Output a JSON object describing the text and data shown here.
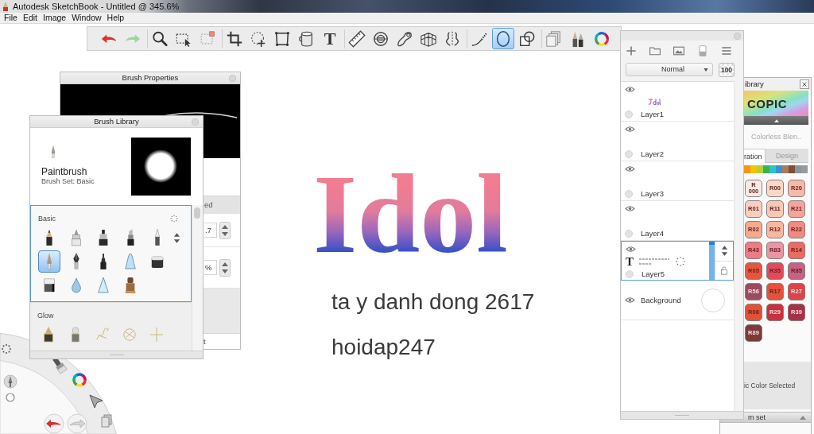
{
  "window": {
    "title": "Autodesk SketchBook - Untitled @ 345.6%"
  },
  "menu": [
    {
      "label": "File"
    },
    {
      "label": "Edit"
    },
    {
      "label": "Image"
    },
    {
      "label": "Window"
    },
    {
      "label": "Help"
    }
  ],
  "toolbar": {
    "groups": [
      {
        "tools": [
          {
            "kind": "undo",
            "selected": false
          },
          {
            "kind": "redo",
            "selected": false
          }
        ]
      },
      {
        "tools": [
          {
            "kind": "zoom",
            "selected": false
          },
          {
            "kind": "select",
            "selected": false
          },
          {
            "kind": "transform",
            "selected": false
          }
        ]
      },
      {
        "tools": [
          {
            "kind": "crop",
            "selected": false
          },
          {
            "kind": "move",
            "selected": false
          },
          {
            "kind": "distort",
            "selected": false
          },
          {
            "kind": "fill",
            "selected": false
          },
          {
            "kind": "text",
            "glyph": "T",
            "selected": false
          }
        ]
      },
      {
        "tools": [
          {
            "kind": "ruler",
            "selected": false
          },
          {
            "kind": "ellipse_guide",
            "selected": false
          },
          {
            "kind": "french_curve",
            "selected": false
          },
          {
            "kind": "perspective",
            "selected": false
          },
          {
            "kind": "symmetry",
            "selected": false
          }
        ]
      },
      {
        "tools": [
          {
            "kind": "stroke",
            "selected": false
          },
          {
            "kind": "ellipse",
            "selected": true
          },
          {
            "kind": "shapes",
            "selected": false
          }
        ]
      },
      {
        "tools": [
          {
            "kind": "copy",
            "selected": false
          },
          {
            "kind": "brushes",
            "selected": false
          },
          {
            "kind": "color",
            "selected": false
          }
        ]
      }
    ]
  },
  "canvas": {
    "lettering": "Idol",
    "lines": [
      "ta y danh dong 2617",
      "hoidap247"
    ]
  },
  "brush_properties": {
    "title": "Brush Properties",
    "tab": "ed",
    "fields": [
      {
        "value": ".7"
      },
      {
        "value": "%"
      }
    ],
    "footer": "t"
  },
  "brush_library": {
    "title": "Brush Library",
    "current": {
      "name": "Paintbrush",
      "set": "Brush Set: Basic"
    },
    "sets": [
      {
        "name": "Basic",
        "brushes": [
          {
            "kind": "pencil",
            "selected": false
          },
          {
            "kind": "technical_pen",
            "selected": false
          },
          {
            "kind": "marker",
            "selected": false
          },
          {
            "kind": "chisel_marker",
            "selected": false
          },
          {
            "kind": "ballpoint",
            "selected": false
          },
          {
            "kind": "paintbrush",
            "selected": true
          },
          {
            "kind": "fountain_pen",
            "selected": false
          },
          {
            "kind": "felt_pen",
            "selected": false
          },
          {
            "kind": "cone",
            "selected": false
          },
          {
            "kind": "eraser_block",
            "selected": false
          },
          {
            "kind": "eraser",
            "selected": false
          },
          {
            "kind": "water_drop",
            "selected": false
          },
          {
            "kind": "triangle",
            "selected": false
          },
          {
            "kind": "stamp",
            "selected": false
          }
        ]
      },
      {
        "name": "Glow",
        "brushes": [
          {
            "kind": "glow_pen",
            "selected": false
          },
          {
            "kind": "glow_marker",
            "selected": false
          },
          {
            "kind": "scribble",
            "selected": false
          },
          {
            "kind": "scribble_circle",
            "selected": false
          },
          {
            "kind": "sparkle",
            "selected": false
          }
        ]
      }
    ]
  },
  "layers": {
    "blend_mode": "Normal",
    "opacity": "100",
    "items": [
      {
        "name": "Layer1",
        "kind": "lettering",
        "visible": true,
        "selected": false
      },
      {
        "name": "Layer2",
        "kind": "empty",
        "visible": true,
        "selected": false
      },
      {
        "name": "Layer3",
        "kind": "empty",
        "visible": true,
        "selected": false
      },
      {
        "name": "Layer4",
        "kind": "empty",
        "visible": true,
        "selected": false
      },
      {
        "name": "Layer5",
        "kind": "text",
        "glyph": "T",
        "visible": true,
        "selected": true
      },
      {
        "name": "Background",
        "kind": "background",
        "visible": true,
        "selected": false
      }
    ]
  },
  "copic": {
    "title": "ibrary",
    "logo": "COPIC",
    "blender": "Colorless Blen..",
    "tabs": [
      {
        "label": "ration",
        "selected": true
      },
      {
        "label": "Design",
        "selected": false
      }
    ],
    "families": [
      {
        "color": "#f7941d"
      },
      {
        "color": "#f5c400"
      },
      {
        "color": "#b5cf3a"
      },
      {
        "color": "#3bae5a"
      },
      {
        "color": "#2ec4c4"
      },
      {
        "color": "#3c8fd2"
      },
      {
        "color": "#a67c5b"
      },
      {
        "color": "#7a4f3a"
      },
      {
        "color": "#8894a0"
      },
      {
        "color": "#9a9a9a"
      }
    ],
    "swatches": [
      {
        "label": "R 000",
        "color": "#f8ece6"
      },
      {
        "label": "R00",
        "color": "#fad9c9"
      },
      {
        "label": "R20",
        "color": "#f7b9aa"
      },
      {
        "label": "R01",
        "color": "#f7d0c2"
      },
      {
        "label": "R11",
        "color": "#f8c8b6"
      },
      {
        "label": "R21",
        "color": "#f3a59c"
      },
      {
        "label": "R02",
        "color": "#f3ab90"
      },
      {
        "label": "R12",
        "color": "#f6b9a0"
      },
      {
        "label": "R22",
        "color": "#f08b82"
      },
      {
        "label": "R43",
        "color": "#ee7b86"
      },
      {
        "label": "R83",
        "color": "#e996a2"
      },
      {
        "label": "R14",
        "color": "#ec6b64"
      },
      {
        "label": "R05",
        "color": "#e8553f"
      },
      {
        "label": "R35",
        "color": "#e04b5b"
      },
      {
        "label": "R85",
        "color": "#c66283"
      },
      {
        "label": "R56",
        "color": "#9b4b5f"
      },
      {
        "label": "R17",
        "color": "#e5513b"
      },
      {
        "label": "R27",
        "color": "#d9454b"
      },
      {
        "label": "R08",
        "color": "#e05136"
      },
      {
        "label": "R29",
        "color": "#c83140"
      },
      {
        "label": "R39",
        "color": "#a63146"
      },
      {
        "label": "R89",
        "color": "#7b3b3b"
      }
    ],
    "status": "ic Color Selected",
    "footer": "m set"
  }
}
